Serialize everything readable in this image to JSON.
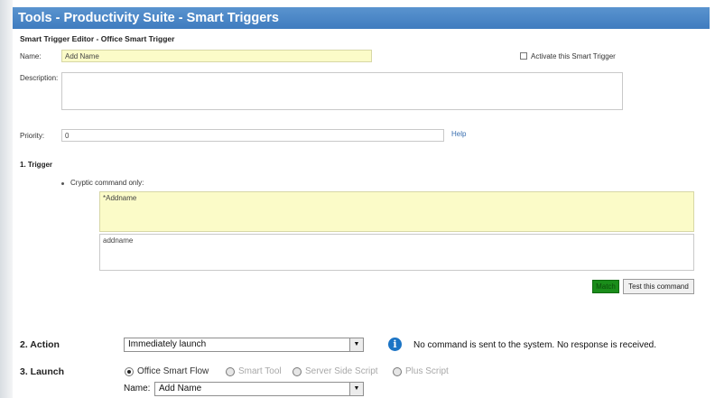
{
  "title": "Tools - Productivity Suite - Smart Triggers",
  "subtitle": "Smart Trigger Editor - Office Smart Trigger",
  "form": {
    "name_label": "Name:",
    "name_value": "Add Name",
    "activate_label": "Activate this Smart Trigger",
    "activate_checked": false,
    "description_label": "Description:",
    "description_value": "",
    "priority_label": "Priority:",
    "priority_value": "0",
    "help_link": "Help"
  },
  "trigger": {
    "heading": "1. Trigger",
    "option_label": "Cryptic command only:",
    "command_value": "*Addname",
    "test_input_value": "addname",
    "match_label": "Match",
    "test_button_label": "Test this command"
  },
  "action": {
    "heading": "2. Action",
    "selected": "Immediately launch",
    "info_message": "No command is sent to the system. No response is received."
  },
  "launch": {
    "heading": "3. Launch",
    "options": [
      "Office Smart Flow",
      "Smart Tool",
      "Server Side Script",
      "Plus Script"
    ],
    "selected_option": "Office Smart Flow",
    "name_label": "Name:",
    "name_selected": "Add Name"
  },
  "colors": {
    "title_bar": "#3f7cbf",
    "yellow_field": "#fbfbc8",
    "match_green": "#1a8d1a",
    "info_blue": "#1b74c5"
  },
  "icons": [
    "checkbox-icon",
    "info-icon",
    "dropdown-arrow-icon",
    "radio-icon"
  ]
}
